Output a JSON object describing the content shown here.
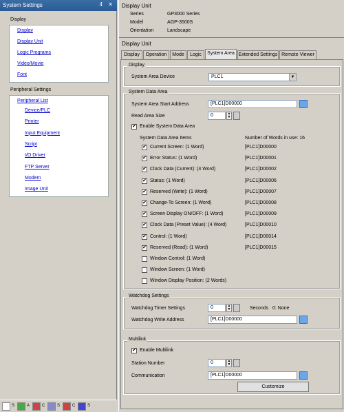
{
  "left": {
    "title": "System Settings",
    "title_buttons": "4 ✕",
    "display_section": "Display",
    "display_links": [
      "Display",
      "Display Unit",
      "Logic Programs",
      "Video/Movie",
      "Font"
    ],
    "peripheral_section": "Peripheral Settings",
    "peripheral_list": "Peripheral List",
    "peripheral_links": [
      "Device/PLC",
      "Printer",
      "Input Equipment",
      "Script",
      "I/O Driver",
      "FTP Server",
      "Modem",
      "Image Unit"
    ],
    "taskbar": [
      "S",
      "A",
      "C",
      "S",
      "C",
      "S"
    ]
  },
  "header": {
    "title": "Display Unit",
    "rows": [
      {
        "k": "Series",
        "v": "GP3000 Series"
      },
      {
        "k": "Model",
        "v": "AGP-3500S"
      },
      {
        "k": "Orientation",
        "v": "Landscape"
      }
    ]
  },
  "section_title": "Display Unit",
  "tabs": [
    "Display",
    "Operation",
    "Mode",
    "Logic",
    "System Area",
    "Extended Settings",
    "Remote Viewer"
  ],
  "display_group": {
    "title": "Display",
    "device_label": "System Area Device",
    "device_value": "PLC1"
  },
  "sda": {
    "title": "System Data Area",
    "start_label": "System Area Start Address",
    "start_value": "[PLC1]D00000",
    "read_label": "Read Area Size",
    "read_value": "0",
    "enable_label": "Enable System Data Area",
    "enable_checked": true,
    "items_header": "System Data Area Items",
    "words_header": "Number of Words in use: 16",
    "items": [
      {
        "label": "Current Screen: (1 Word)",
        "addr": "[PLC1]D00000",
        "checked": true
      },
      {
        "label": "Error Status: (1 Word)",
        "addr": "[PLC1]D00001",
        "checked": true
      },
      {
        "label": "Clock Data (Current): (4 Word)",
        "addr": "[PLC1]D00002",
        "checked": true
      },
      {
        "label": "Status: (1 Word)",
        "addr": "[PLC1]D00006",
        "checked": true
      },
      {
        "label": "Reserved (Write): (1 Word)",
        "addr": "[PLC1]D00007",
        "checked": true
      },
      {
        "label": "Change-To Screen: (1 Word)",
        "addr": "[PLC1]D00008",
        "checked": true
      },
      {
        "label": "Screen Display ON/OFF: (1 Word)",
        "addr": "[PLC1]D00009",
        "checked": true
      },
      {
        "label": "Clock Data (Preset Value): (4 Word)",
        "addr": "[PLC1]D00010",
        "checked": true
      },
      {
        "label": "Control: (1 Word)",
        "addr": "[PLC1]D00014",
        "checked": true
      },
      {
        "label": "Reserved (Read): (1 Word)",
        "addr": "[PLC1]D00015",
        "checked": true
      },
      {
        "label": "Window Control: (1 Word)",
        "addr": "",
        "checked": false
      },
      {
        "label": "Window Screen: (1 Word)",
        "addr": "",
        "checked": false
      },
      {
        "label": "Window Display Position: (2 Words)",
        "addr": "",
        "checked": false
      }
    ]
  },
  "watchdog": {
    "title": "Watchdog Settings",
    "timer_label": "Watchdog Timer Settings",
    "timer_value": "0",
    "seconds_label": "Seconds",
    "none_label": "0: None",
    "write_label": "Watchdog Write Address",
    "write_value": "[PLC1]D00000"
  },
  "multilink": {
    "title": "Multilink",
    "enable_label": "Enable Multilink",
    "enable_checked": true,
    "station_label": "Station Number",
    "station_value": "0",
    "comm_label": "Communication",
    "comm_value": "[PLC1]D00000",
    "customize": "Customize"
  }
}
